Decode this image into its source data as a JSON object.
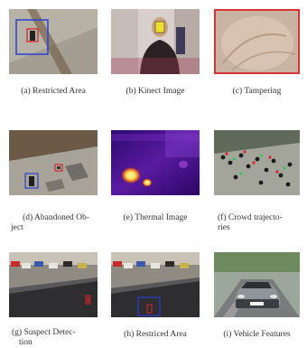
{
  "figures": [
    {
      "id": "a",
      "caption": "(a) Restricted Area",
      "scene": "restricted-area"
    },
    {
      "id": "b",
      "caption": "(b) Kinect Image",
      "scene": "kinect-image"
    },
    {
      "id": "c",
      "caption": "(c) Tampering",
      "scene": "tampering"
    },
    {
      "id": "d",
      "caption_line1": "(d) Abandoned Ob-",
      "caption_line2": "ject",
      "scene": "abandoned-object"
    },
    {
      "id": "e",
      "caption": "(e) Thermal Image",
      "scene": "thermal-image"
    },
    {
      "id": "f",
      "caption_line1": "(f) Crowd trajecto-",
      "caption_line2": "ries",
      "scene": "crowd-trajectories"
    },
    {
      "id": "g",
      "caption_line1": "(g) Suspect Detec-",
      "caption_line2": "tion",
      "scene": "suspect-detection"
    },
    {
      "id": "h",
      "caption": "(h) Restriced Area",
      "scene": "restricted-area-parking"
    },
    {
      "id": "i",
      "caption": "(i) Vehicle Features",
      "scene": "vehicle-features"
    }
  ],
  "colors": {
    "highlight_red": "#d8262b",
    "highlight_blue": "#2b3fd0",
    "thermal_purple": "#3a0a8a",
    "thermal_hot": "#f7e35a"
  }
}
